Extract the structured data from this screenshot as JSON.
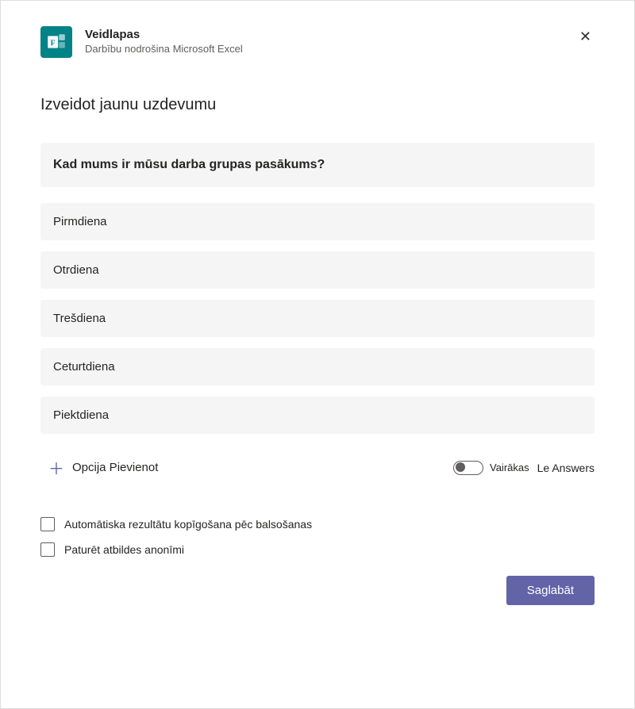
{
  "header": {
    "app_title": "Veidlapas",
    "app_subtitle": "Darbību nodrošina Microsoft Excel"
  },
  "page_title": "Izveidot jaunu uzdevumu",
  "question": "Kad mums ir mūsu darba grupas pasākums?",
  "options": [
    "Pirmdiena",
    "Otrdiena",
    "Trešdiena",
    "Ceturtdiena",
    "Piektdiena"
  ],
  "add_option_label": "Opcija Pievienot",
  "multiple_toggle_label1": "Vairākas",
  "multiple_toggle_label2": "Le Answers",
  "checkboxes": {
    "auto_share": "Automātiska rezultātu kopīgošana pēc balsošanas",
    "keep_anonymous": "Paturēt atbildes anonīmi"
  },
  "save_label": "Saglabāt"
}
